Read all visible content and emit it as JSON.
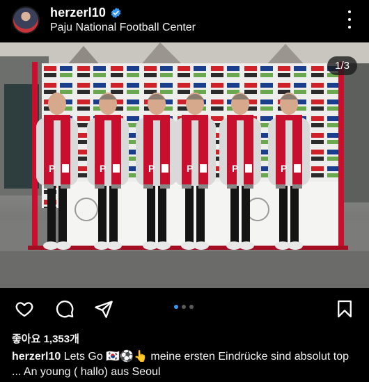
{
  "post": {
    "username": "herzerl10",
    "location": "Paju National Football Center",
    "image_counter": "1/3",
    "likes_text": "좋아요 1,353개",
    "caption_user": "herzerl10",
    "caption_text": "Lets Go 🇰🇷⚽👆 meine ersten Eindrücke sind absolut top ... An young ( hallo) aus Seoul"
  },
  "photo": {
    "backdrop_logos": [
      "kt",
      "교보생명",
      "hana",
      "KEB"
    ],
    "board_texts": [
      "대한축구협회",
      "Korea Football Association"
    ],
    "scarf_letter": "P"
  },
  "carousel": {
    "total": 3,
    "active": 0
  },
  "colors": {
    "background": "#000000",
    "accent_verified": "#3897f0",
    "carousel_active": "#3897f0",
    "scarf_red": "#c8102e"
  },
  "icons": [
    "heart-icon",
    "comment-icon",
    "share-icon",
    "bookmark-icon",
    "more-options-icon",
    "verified-badge-icon"
  ]
}
